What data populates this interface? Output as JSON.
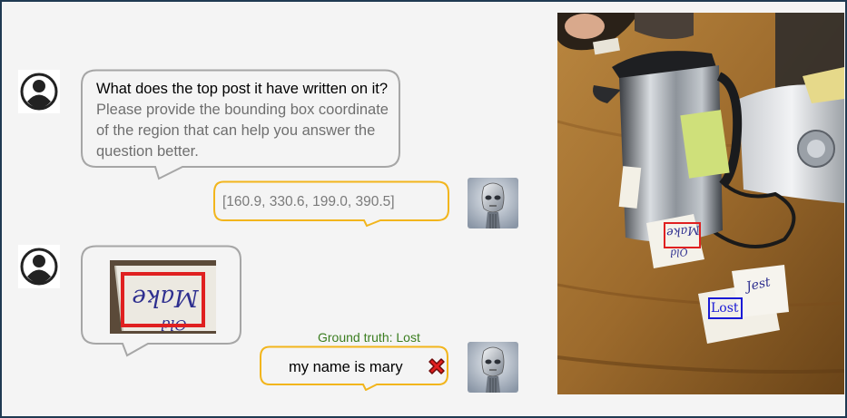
{
  "conversation": {
    "question_main": "What does the top post it have written on it?",
    "question_instruction": "Please provide the bounding box coordinate of the region that can help you answer the question better.",
    "bbox_answer": "[160.9, 330.6, 199.0, 390.5]",
    "ground_truth": "Ground truth: Lost",
    "final_answer": "my name is mary"
  },
  "icons": {
    "user": "user-avatar-icon",
    "model": "robot-avatar-icon",
    "wrong": "red-x-icon"
  },
  "colors": {
    "user_bubble_border": "#a6a6a6",
    "model_bubble_border": "#f2b51c",
    "predicted_box": "#e02020",
    "ground_truth_box": "#1a1ad6",
    "ground_truth_text": "#3a7d1f",
    "frame_border": "#1f3a52"
  },
  "photo": {
    "note_red_text": "Make",
    "note_red_under": "Old",
    "note_blue_text": "Lost",
    "note_blue_side": "Jest",
    "crop_text": "Make",
    "crop_under": "Old"
  }
}
